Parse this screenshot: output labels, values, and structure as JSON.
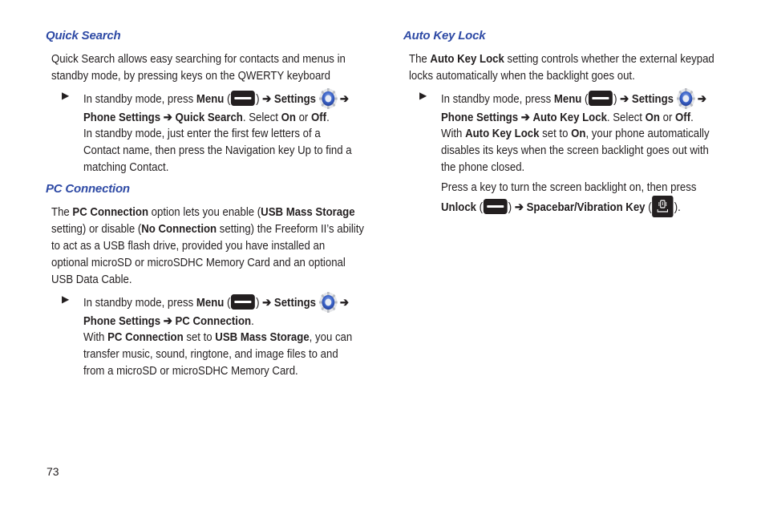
{
  "page_number": "73",
  "colors": {
    "heading": "#2e4aa5",
    "text": "#231f20"
  },
  "left": {
    "quick_search": {
      "heading": "Quick Search",
      "intro_line1": "Quick Search allows easy searching for contacts and menus in",
      "intro_line2": "standby mode, by pressing keys on the QWERTY keyboard",
      "step": {
        "t1": "In standby mode, press ",
        "menu": "Menu",
        "open_paren": " (",
        "close_paren": ") ",
        "arrow": "➔",
        "settings": "Settings",
        "phone_settings": "Phone Settings",
        "target": "Quick Search",
        "select": ". Select ",
        "on": "On",
        "or": " or ",
        "off": "Off",
        "end": "."
      },
      "note_line1": "In standby mode, just enter the first few letters of a",
      "note_line2": "Contact name, then press the Navigation key Up to find a",
      "note_line3": "matching Contact."
    },
    "pc_connection": {
      "heading": "PC Connection",
      "p1_a": "The ",
      "p1_b": "PC Connection",
      "p1_c": " option lets you enable (",
      "p1_d": "USB Mass Storage",
      "p2_a": "setting) or disable (",
      "p2_b": "No Connection",
      "p2_c": " setting) the Freeform II’s ability",
      "p3": "to act as a USB flash drive, provided you have installed an",
      "p4": "optional microSD or microSDHC Memory Card and an optional",
      "p5": "USB Data Cable.",
      "step": {
        "t1": "In standby mode, press ",
        "menu": "Menu",
        "settings": "Settings",
        "phone_settings": "Phone Settings",
        "target": "PC Connection",
        "end": "."
      },
      "note_a": "With ",
      "note_b": "PC Connection",
      "note_c": " set to ",
      "note_d": "USB Mass Storage",
      "note_e": ", you can",
      "note_line2": "transfer music, sound, ringtone, and image files to and",
      "note_line3": "from a microSD or microSDHC Memory Card."
    }
  },
  "right": {
    "auto_key_lock": {
      "heading": "Auto Key Lock",
      "p1_a": "The ",
      "p1_b": "Auto Key Lock",
      "p1_c": " setting controls whether the external keypad",
      "p2": "locks automatically when the backlight goes out.",
      "step": {
        "t1": "In standby mode, press ",
        "menu": "Menu",
        "settings": "Settings",
        "phone_settings": "Phone Settings",
        "target": "Auto Key Lock",
        "select": ". Select ",
        "on": "On",
        "or": " or ",
        "off": "Off",
        "end": "."
      },
      "note_a": "With ",
      "note_b": "Auto Key Lock",
      "note_c": " set to ",
      "note_d": "On",
      "note_e": ", your phone automatically",
      "note_line2": "disables its keys when the screen backlight goes out with",
      "note_line3": "the phone closed.",
      "unlock_line1": "Press a key to turn the screen backlight on, then press",
      "unlock": "Unlock",
      "spacebar": "Spacebar/Vibration Key",
      "unlock_end": ")."
    }
  },
  "icons": {
    "bullet": "▶",
    "menu_key": "menu-key-icon",
    "settings": "gear-icon",
    "spacebar": "vibration-key-icon"
  }
}
